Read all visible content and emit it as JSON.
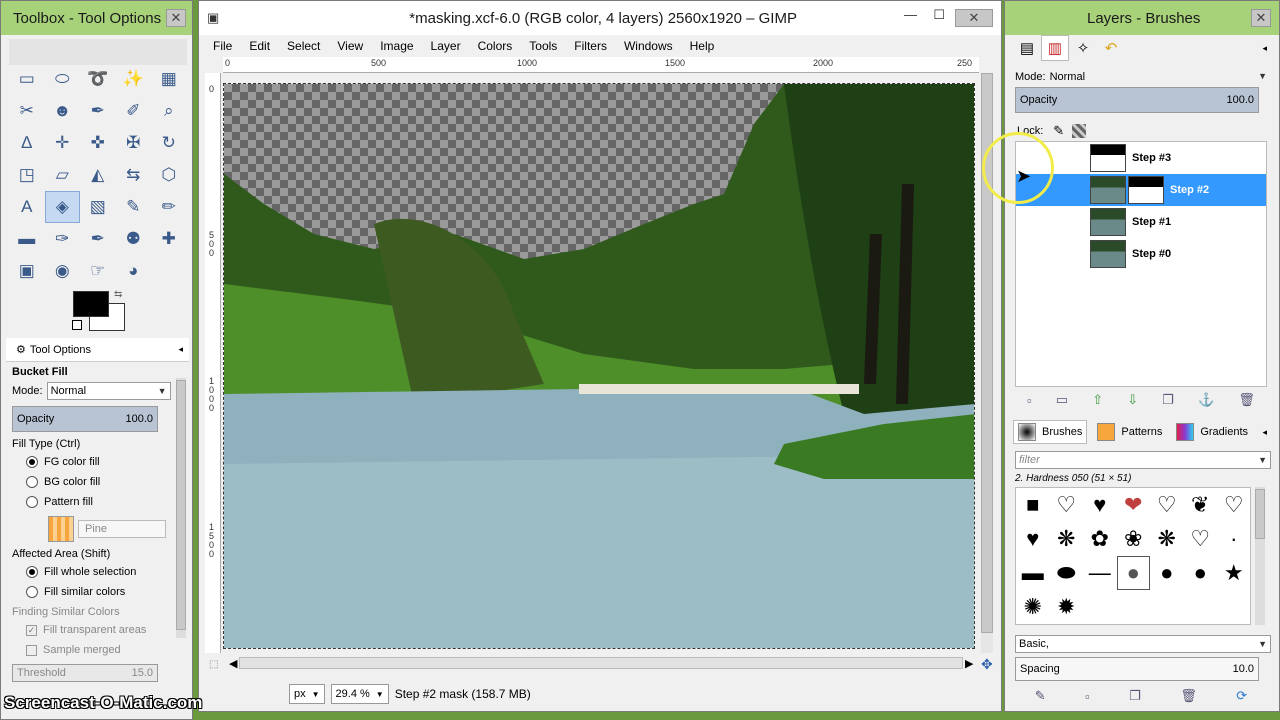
{
  "toolbox": {
    "title": "Toolbox - Tool Options",
    "close": "✕",
    "tools": [
      {
        "name": "rect-select-icon",
        "glyph": "▭"
      },
      {
        "name": "ellipse-select-icon",
        "glyph": "⬭"
      },
      {
        "name": "free-select-icon",
        "glyph": "➰"
      },
      {
        "name": "fuzzy-select-icon",
        "glyph": "✨"
      },
      {
        "name": "color-select-icon",
        "glyph": "▦"
      },
      {
        "name": "scissors-select-icon",
        "glyph": "✂"
      },
      {
        "name": "foreground-select-icon",
        "glyph": "☻"
      },
      {
        "name": "paths-icon",
        "glyph": "✒"
      },
      {
        "name": "color-picker-icon",
        "glyph": "✐"
      },
      {
        "name": "zoom-icon",
        "glyph": "⌕"
      },
      {
        "name": "measure-icon",
        "glyph": "∆"
      },
      {
        "name": "move-icon",
        "glyph": "✛"
      },
      {
        "name": "align-icon",
        "glyph": "✜"
      },
      {
        "name": "crop-icon",
        "glyph": "✠"
      },
      {
        "name": "rotate-icon",
        "glyph": "↻"
      },
      {
        "name": "scale-icon",
        "glyph": "◳"
      },
      {
        "name": "shear-icon",
        "glyph": "▱"
      },
      {
        "name": "perspective-icon",
        "glyph": "◭"
      },
      {
        "name": "flip-icon",
        "glyph": "⇆"
      },
      {
        "name": "cage-icon",
        "glyph": "⬡"
      },
      {
        "name": "text-icon",
        "glyph": "A"
      },
      {
        "name": "bucket-fill-icon",
        "glyph": "◈"
      },
      {
        "name": "blend-icon",
        "glyph": "▧"
      },
      {
        "name": "pencil-icon",
        "glyph": "✎"
      },
      {
        "name": "paintbrush-icon",
        "glyph": "✏"
      },
      {
        "name": "eraser-icon",
        "glyph": "▬"
      },
      {
        "name": "airbrush-icon",
        "glyph": "✑"
      },
      {
        "name": "ink-icon",
        "glyph": "✒"
      },
      {
        "name": "clone-icon",
        "glyph": "⚉"
      },
      {
        "name": "heal-icon",
        "glyph": "✚"
      },
      {
        "name": "perspective-clone-icon",
        "glyph": "▣"
      },
      {
        "name": "blur-icon",
        "glyph": "◉"
      },
      {
        "name": "smudge-icon",
        "glyph": "☞"
      },
      {
        "name": "dodge-burn-icon",
        "glyph": "◕"
      }
    ],
    "tool_options_tab": "Tool Options",
    "tool_name": "Bucket Fill",
    "mode_label": "Mode:",
    "mode_value": "Normal",
    "opacity_label": "Opacity",
    "opacity_value": "100.0",
    "fill_type_label": "Fill Type  (Ctrl)",
    "fill_types": [
      "FG color fill",
      "BG color fill",
      "Pattern fill"
    ],
    "pattern_name": "Pine",
    "affected_label": "Affected Area  (Shift)",
    "affected": [
      "Fill whole selection",
      "Fill similar colors"
    ],
    "finding_label": "Finding Similar Colors",
    "fill_transparent": "Fill transparent areas",
    "sample_merged": "Sample merged",
    "threshold_label": "Threshold",
    "threshold_value": "15.0"
  },
  "image": {
    "title": "*masking.xcf-6.0 (RGB color, 4 layers) 2560x1920 – GIMP",
    "menu": [
      "File",
      "Edit",
      "Select",
      "View",
      "Image",
      "Layer",
      "Colors",
      "Tools",
      "Filters",
      "Windows",
      "Help"
    ],
    "ruler_h": [
      "0",
      "500",
      "1000",
      "1500",
      "2000",
      "250"
    ],
    "ruler_v": [
      "0",
      "5\n0\n0",
      "1\n0\n0\n0",
      "1\n5\n0\n0"
    ],
    "unit": "px",
    "zoom": "29.4 %",
    "status": "Step #2 mask (158.7 MB)"
  },
  "layers": {
    "title": "Layers - Brushes",
    "mode_label": "Mode:",
    "mode_value": "Normal",
    "opacity_label": "Opacity",
    "opacity_value": "100.0",
    "lock_label": "Lock:",
    "items": [
      {
        "name": "Step #3",
        "mask": true,
        "selected": false,
        "image": false
      },
      {
        "name": "Step #2",
        "mask": true,
        "selected": true,
        "image": true
      },
      {
        "name": "Step #1",
        "mask": false,
        "selected": false,
        "image": true
      },
      {
        "name": "Step #0",
        "mask": false,
        "selected": false,
        "image": true
      }
    ],
    "brush_tabs": [
      "Brushes",
      "Patterns",
      "Gradients"
    ],
    "filter_placeholder": "filter",
    "brush_name": "2. Hardness 050 (51 × 51)",
    "brush_set": "Basic,",
    "spacing_label": "Spacing",
    "spacing_value": "10.0"
  },
  "watermark": "Screencast-O-Matic.com"
}
